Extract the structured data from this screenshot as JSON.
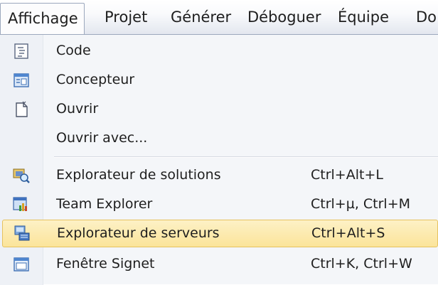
{
  "menubar": {
    "items": [
      {
        "label": "Affichage"
      },
      {
        "label": "Projet"
      },
      {
        "label": "Générer"
      },
      {
        "label": "Déboguer"
      },
      {
        "label": "Équipe"
      },
      {
        "label": "Do"
      }
    ]
  },
  "menu": {
    "items": [
      {
        "icon": "code-icon",
        "label": "Code",
        "shortcut": ""
      },
      {
        "icon": "designer-icon",
        "label": "Concepteur",
        "shortcut": ""
      },
      {
        "icon": "open-file-icon",
        "label": "Ouvrir",
        "shortcut": ""
      },
      {
        "icon": "",
        "label": "Ouvrir avec...",
        "shortcut": ""
      },
      {
        "icon": "solution-explorer-icon",
        "label": "Explorateur de solutions",
        "shortcut": "Ctrl+Alt+L"
      },
      {
        "icon": "team-explorer-icon",
        "label": "Team Explorer",
        "shortcut": "Ctrl+µ, Ctrl+M"
      },
      {
        "icon": "server-explorer-icon",
        "label": "Explorateur de serveurs",
        "shortcut": "Ctrl+Alt+S"
      },
      {
        "icon": "bookmark-window-icon",
        "label": "Fenêtre Signet",
        "shortcut": "Ctrl+K, Ctrl+W"
      }
    ]
  },
  "colors": {
    "highlight": "#fbe49a",
    "highlight_border": "#e6c25f",
    "menu_background": "#f4f6f9",
    "text": "#1e1e1e"
  }
}
